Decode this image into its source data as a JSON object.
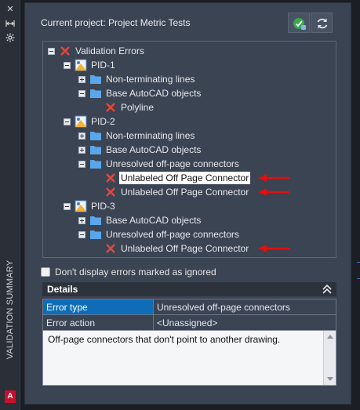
{
  "palette": "Validation Summary",
  "strip": {
    "title": "VALIDATION SUMMARY",
    "close_icon": "close-icon",
    "autohide_icon": "autohide-icon",
    "settings_icon": "settings-icon",
    "app_badge": "A"
  },
  "header": {
    "project_label": "Current project: Project Metric Tests",
    "validate_icon": "validate-check-icon",
    "refresh_icon": "refresh-icon"
  },
  "tree": {
    "root": {
      "label": "Validation Errors",
      "icon": "error-x-icon"
    },
    "pid1": {
      "label": "PID-1",
      "children": {
        "nonterm": "Non-terminating lines",
        "base": "Base AutoCAD objects",
        "polyline": "Polyline"
      }
    },
    "pid2": {
      "label": "PID-2",
      "children": {
        "nonterm": "Non-terminating lines",
        "base": "Base AutoCAD objects",
        "unresolved": "Unresolved off-page connectors",
        "opc1": "Unlabeled Off Page Connector",
        "opc2": "Unlabeled Off Page Connector"
      }
    },
    "pid3": {
      "label": "PID-3",
      "children": {
        "base": "Base AutoCAD objects",
        "unresolved": "Unresolved off-page connectors",
        "opc1": "Unlabeled Off Page Connector"
      }
    }
  },
  "ignore_checkbox": {
    "label": "Don't display errors marked as ignored",
    "checked": false
  },
  "details": {
    "title": "Details",
    "rows": [
      {
        "key": "Error type",
        "value": "Unresolved off-page connectors"
      },
      {
        "key": "Error action",
        "value": "<Unassigned>"
      }
    ],
    "description": "Off-page connectors that don't point to another drawing."
  },
  "colors": {
    "panel": "#3b4453",
    "selected_row": "#0f6db7",
    "error_x": "#e8463a",
    "arrow": "#e01010",
    "folder": "#5aa6ea"
  }
}
